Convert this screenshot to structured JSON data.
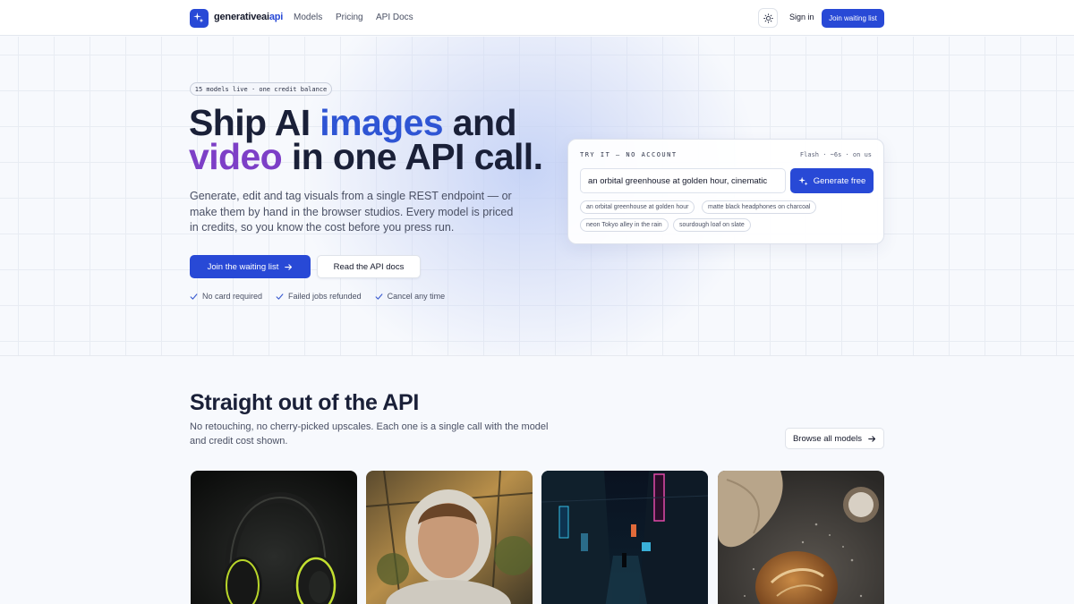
{
  "nav": {
    "brand_prefix": "generativeai",
    "brand_suffix": "api",
    "links": [
      "Models",
      "Pricing",
      "API Docs"
    ],
    "signin": "Sign in",
    "cta": "Join waiting list"
  },
  "hero": {
    "badge": "15 models live · one credit balance",
    "headline": {
      "part1": "Ship AI ",
      "part2": "images",
      "part3": " and",
      "part4": "video",
      "part5": " in one API call."
    },
    "lead": "Generate, edit and tag visuals from a single REST endpoint — or make them by hand in the browser studios. Every model is priced in credits, so you know the cost before you press run.",
    "primary_button": "Join the waiting list",
    "secondary_button": "Read the API docs",
    "checks": [
      "No card required",
      "Failed jobs refunded",
      "Cancel any time"
    ]
  },
  "try_panel": {
    "label": "TRY IT — NO ACCOUNT",
    "meta": "Flash · ~6s · on us",
    "input_value": "an orbital greenhouse at golden hour, cinematic",
    "button": "Generate free",
    "chips": [
      "an orbital greenhouse at golden hour",
      "matte black headphones on charcoal",
      "neon Tokyo alley in the rain",
      "sourdough loaf on slate"
    ]
  },
  "gallery": {
    "title": "Straight out of the API",
    "subtitle": "No retouching, no cherry-picked upscales. Each one is a single call with the model and credit cost shown.",
    "browse_button": "Browse all models"
  },
  "colors": {
    "primary": "#2849d6",
    "headline_blue": "#2f55d4",
    "headline_purple": "#7d3fc7"
  }
}
